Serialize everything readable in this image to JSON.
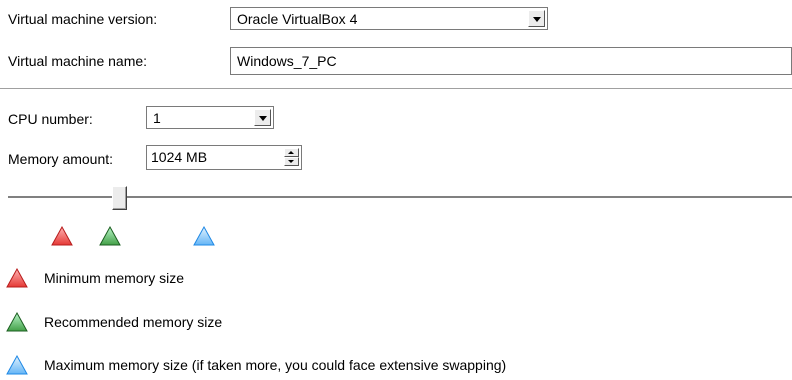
{
  "form": {
    "vm_version_label": "Virtual machine version:",
    "vm_version_value": "Oracle VirtualBox 4",
    "vm_name_label": "Virtual machine name:",
    "vm_name_value": "Windows_7_PC",
    "cpu_label": "CPU number:",
    "cpu_value": "1",
    "memory_label": "Memory amount:",
    "memory_value": "1024 MB"
  },
  "slider": {
    "level_fraction": 0.14
  },
  "markers": [
    {
      "name": "minimum",
      "color": "#e53935"
    },
    {
      "name": "recommended",
      "color": "#43a047"
    },
    {
      "name": "maximum",
      "color": "#64b5f6"
    }
  ],
  "legend": {
    "min": "Minimum memory size",
    "recommended": "Recommended memory size",
    "max": "Maximum memory size (if taken more, you could face extensive swapping)"
  },
  "colors": {
    "red": "#e53935",
    "green": "#43a047",
    "blue": "#64b5f6"
  },
  "icons": {
    "dropdown": "chevron-down-icon",
    "spin": "spin-updown-icon",
    "min_marker": "red-triangle-icon",
    "rec_marker": "green-triangle-icon",
    "max_marker": "blue-triangle-icon"
  }
}
